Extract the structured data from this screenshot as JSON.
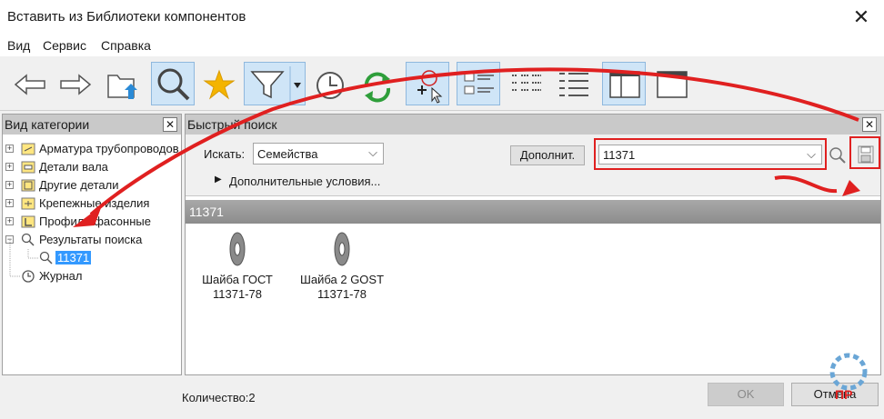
{
  "window": {
    "title": "Вставить из Библиотеки компонентов",
    "close": "✕"
  },
  "menu": {
    "items": [
      "Вид",
      "Сервис",
      "Справка"
    ]
  },
  "left_panel": {
    "title": "Вид категории",
    "close": "✕",
    "tree": [
      {
        "label": "Арматура трубопроводов"
      },
      {
        "label": "Детали вала"
      },
      {
        "label": "Другие детали"
      },
      {
        "label": "Крепежные изделия"
      },
      {
        "label": "Профили фасонные"
      },
      {
        "label": "Результаты поиска"
      },
      {
        "label": "11371"
      },
      {
        "label": "Журнал"
      }
    ]
  },
  "search_panel": {
    "title": "Быстрый поиск",
    "close": "✕",
    "search_in_label": "Искать:",
    "search_in_value": "Семейства",
    "more_button": "Дополнит.",
    "query": "11371",
    "extra_conditions": "Дополнительные условия...",
    "expand_glyph": "▶",
    "dropdown_glyph": "⌵"
  },
  "results": {
    "header": "11371",
    "items": [
      {
        "line1": "Шайба  ГОСТ",
        "line2": "11371-78"
      },
      {
        "line1": "Шайба 2 GOST",
        "line2": "11371-78"
      }
    ]
  },
  "status": {
    "count": "Количество:2"
  },
  "buttons": {
    "ok": "OK",
    "cancel": "Отмена"
  },
  "watermark": {
    "text": "ПР"
  },
  "colors": {
    "accent": "#e02020",
    "selection": "#3399ff",
    "active_tool": "#cfe5f7"
  }
}
